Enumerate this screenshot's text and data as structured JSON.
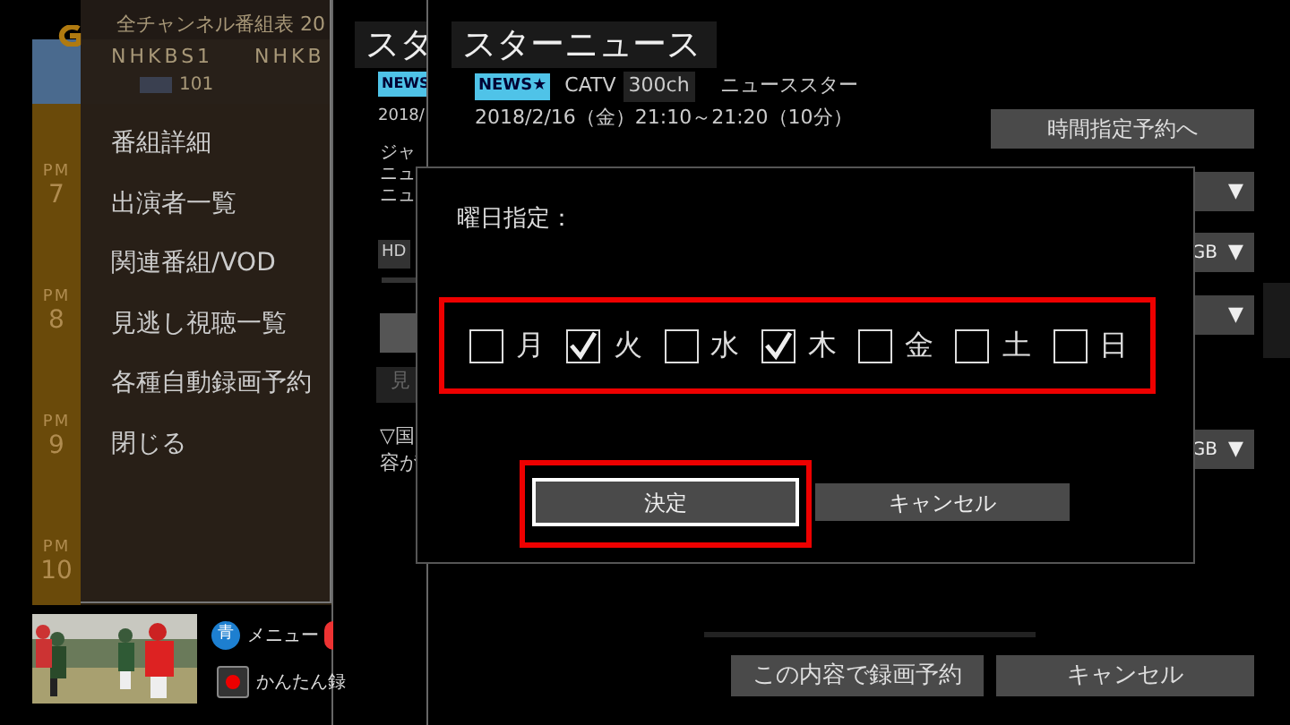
{
  "epg": {
    "title": "全チャンネル番組表 20",
    "channels": [
      {
        "name": "NHKBS1",
        "number": "101"
      },
      {
        "name": "NHKB"
      }
    ],
    "times": [
      {
        "period": "PM",
        "hour": "7"
      },
      {
        "period": "PM",
        "hour": "8"
      },
      {
        "period": "PM",
        "hour": "9"
      },
      {
        "period": "PM",
        "hour": "10"
      }
    ]
  },
  "context_menu": {
    "items": [
      "番組詳細",
      "出演者一覧",
      "関連番組/VOD",
      "見逃し視聴一覧",
      "各種自動録画予約",
      "閉じる"
    ]
  },
  "preview": {
    "kind": "picture",
    "keys": [
      {
        "kind": "blue",
        "glyph": "青",
        "label": "メニュー"
      },
      {
        "kind": "record",
        "label": "かんたん録"
      }
    ]
  },
  "back_panel": {
    "title": "スタ",
    "badge": "NEWS",
    "date": "2018/",
    "lines": [
      "ジャ",
      "ニュ",
      "ニュ"
    ],
    "storage": "HD",
    "button": "見",
    "notes": [
      "▽国",
      "容が"
    ]
  },
  "detail": {
    "title": "スターニュース",
    "badge": "NEWS★",
    "network": "CATV",
    "channel": "300ch",
    "station": "ニューススター",
    "datetime": "2018/2/16（金）21:10～21:20（10分）",
    "time_reserve_button": "時間指定予約へ",
    "dropdowns": [
      {
        "arrow": "▼"
      },
      {
        "value": "GB",
        "arrow": "▼"
      },
      {
        "arrow": "▼"
      },
      {
        "value": "GB",
        "arrow": "▼"
      }
    ],
    "buttons": [
      "この内容で録画予約",
      "キャンセル"
    ]
  },
  "dialog": {
    "label": "曜日指定：",
    "highlighted": true,
    "days": [
      {
        "label": "月",
        "checked": false
      },
      {
        "label": "火",
        "checked": true
      },
      {
        "label": "水",
        "checked": false
      },
      {
        "label": "木",
        "checked": true
      },
      {
        "label": "金",
        "checked": false
      },
      {
        "label": "土",
        "checked": false
      },
      {
        "label": "日",
        "checked": false
      }
    ],
    "buttons": [
      {
        "label": "決定",
        "focused": true,
        "highlighted": true
      },
      {
        "label": "キャンセル",
        "focused": false,
        "highlighted": false
      }
    ]
  }
}
